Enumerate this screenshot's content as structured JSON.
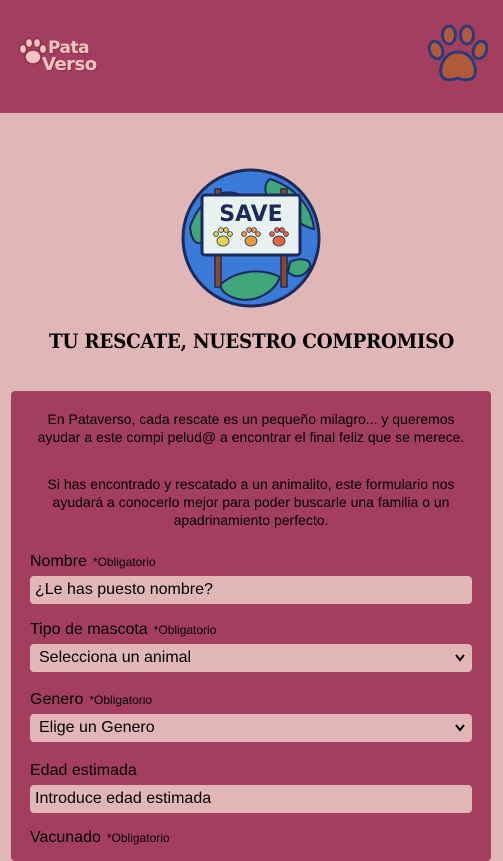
{
  "header": {
    "logo_line1": "Pata",
    "logo_line2": "Verso",
    "profile_icon": "paw-icon"
  },
  "hero": {
    "sign_text": "SAVE",
    "title": "TU RESCATE, NUESTRO COMPROMISO"
  },
  "intro": {
    "p1": "En Pataverso, cada rescate es un pequeño milagro... y queremos ayudar a este compi pelud@ a encontrar el final feliz que se merece.",
    "p2": "Si has encontrado y rescatado a un animalito, este formulario nos ayudará a conocerlo mejor para poder buscarle una familia o un apadrinamiento perfecto."
  },
  "form": {
    "required_label": "*Obligatorio",
    "nombre": {
      "label": "Nombre",
      "placeholder": "¿Le has puesto nombre?"
    },
    "tipo": {
      "label": "Tipo de mascota",
      "selected": "Selecciona un animal"
    },
    "genero": {
      "label": "Genero",
      "selected": "Elige un Genero"
    },
    "edad": {
      "label": "Edad estimada",
      "placeholder": "Introduce edad estimada"
    },
    "vacunado": {
      "label": "Vacunado"
    }
  },
  "colors": {
    "header_bg": "#a43e5f",
    "page_bg": "#e0b6b7",
    "card_bg": "#a43e5f",
    "input_bg": "#e0b6b7"
  }
}
